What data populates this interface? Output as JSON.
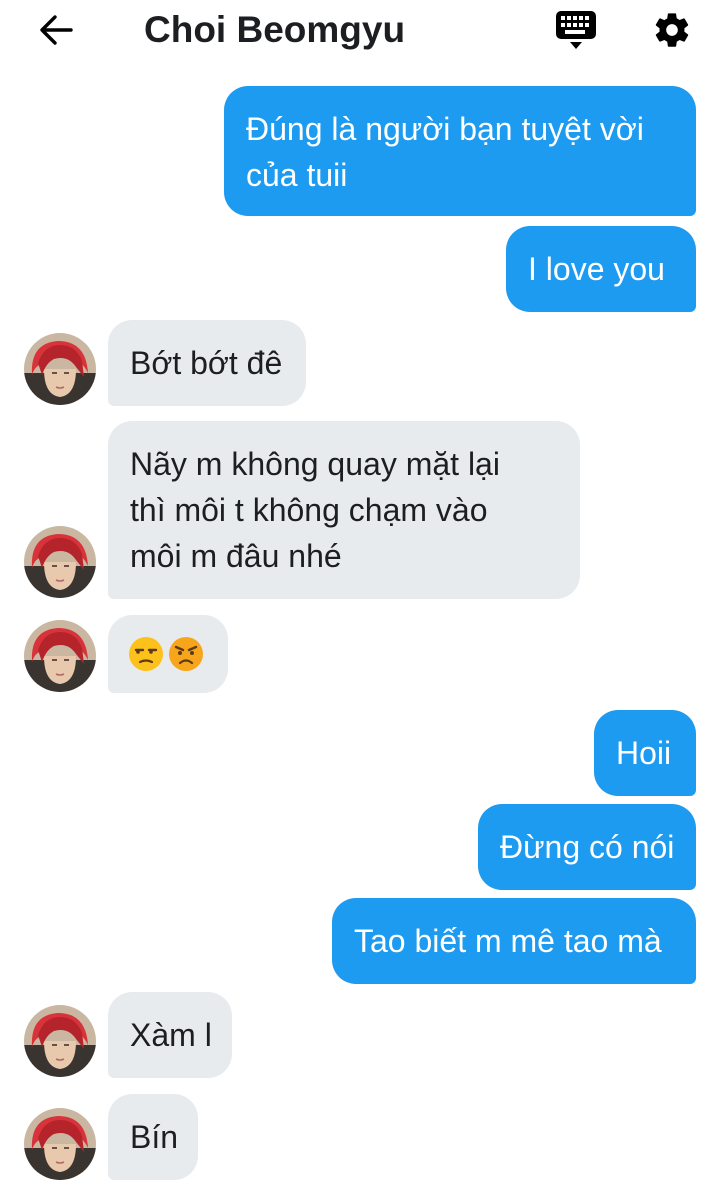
{
  "header": {
    "title": "Choi Beomgyu",
    "back_icon": "arrow-left-icon",
    "keyboard_icon": "keyboard-icon",
    "settings_icon": "gear-icon"
  },
  "colors": {
    "outgoing_bubble": "#1d9bf0",
    "incoming_bubble": "#e8ebee",
    "text_dark": "#1c1e21"
  },
  "messages": [
    {
      "from": "me",
      "lines": [
        "Đúng là người bạn tuyệt vời",
        "của tuii"
      ]
    },
    {
      "from": "me",
      "lines": [
        "I love you"
      ]
    },
    {
      "from": "them",
      "lines": [
        "Bớt bớt đê"
      ]
    },
    {
      "from": "them",
      "lines": [
        "Nãy m không quay mặt lại",
        "thì môi t không chạm vào",
        "môi m đâu nhé"
      ]
    },
    {
      "from": "them",
      "emojis": [
        "unamused-face-emoji",
        "angry-face-emoji"
      ]
    },
    {
      "from": "me",
      "lines": [
        "Hoii"
      ]
    },
    {
      "from": "me",
      "lines": [
        "Đừng có nói"
      ]
    },
    {
      "from": "me",
      "lines": [
        "Tao biết m mê tao mà"
      ]
    },
    {
      "from": "them",
      "lines": [
        "Xàm l"
      ]
    },
    {
      "from": "them",
      "lines": [
        "Bín"
      ]
    }
  ]
}
